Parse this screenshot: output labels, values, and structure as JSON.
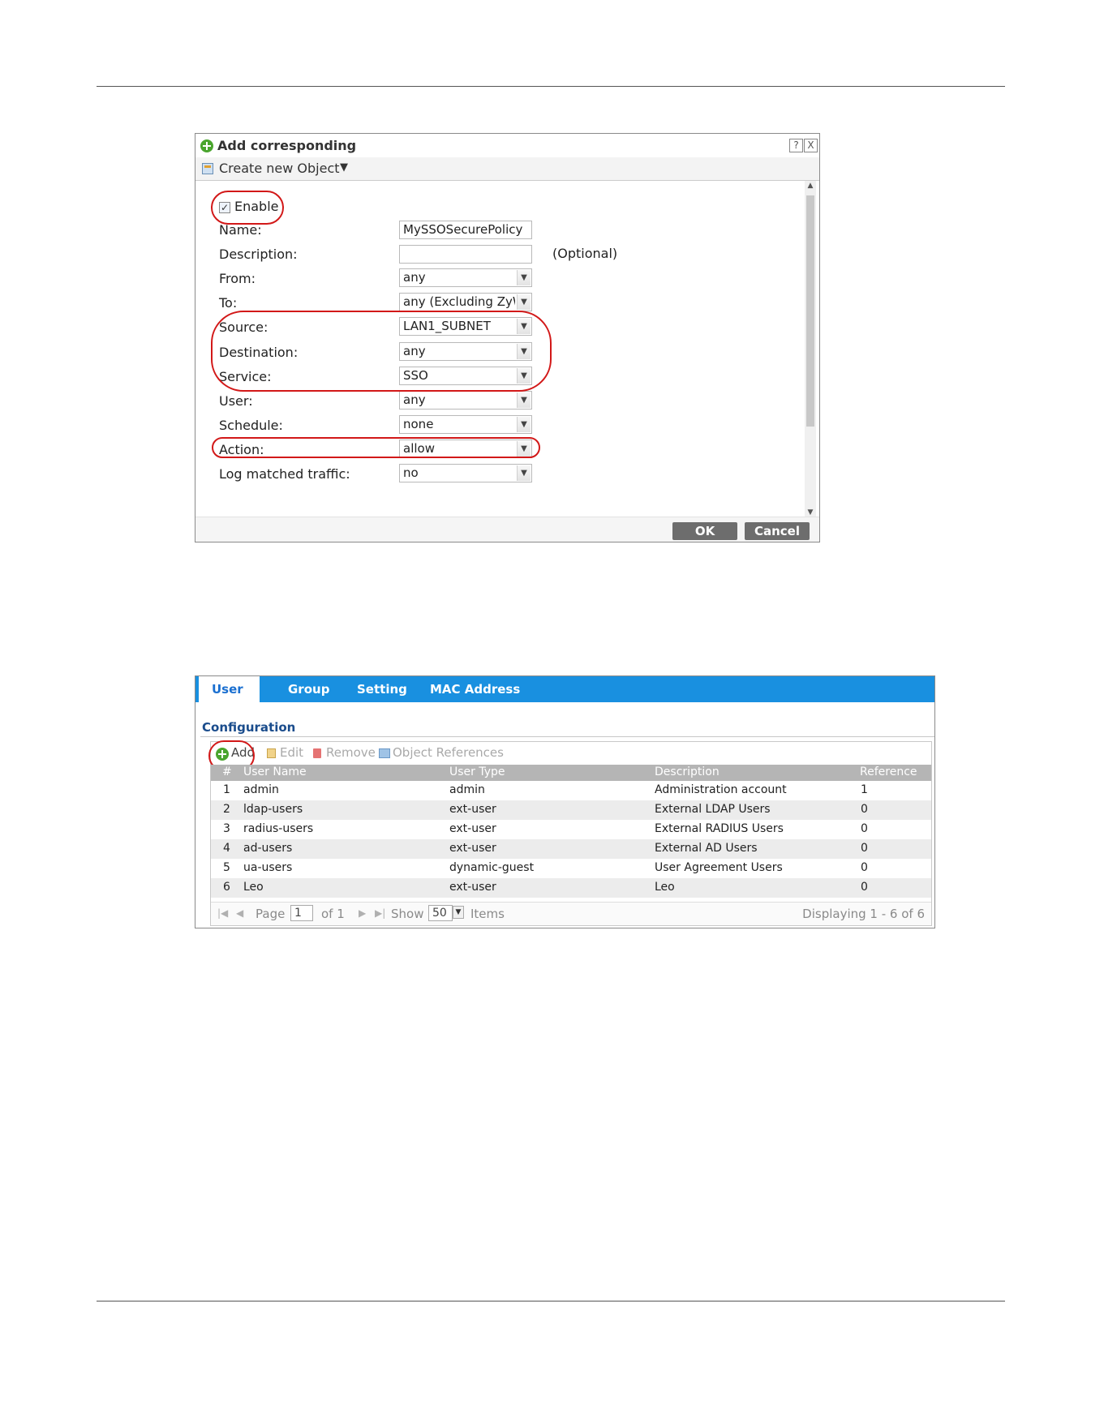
{
  "dialog": {
    "title": "Add corresponding",
    "help_label": "?",
    "close_label": "X",
    "create_new_object": "Create new Object",
    "create_caret": "▼",
    "enable_label": "Enable",
    "enable_checked": true,
    "fields": {
      "name": {
        "label": "Name:",
        "value": "MySSOSecurePolicy"
      },
      "description": {
        "label": "Description:",
        "value": "",
        "hint": "(Optional)"
      },
      "from": {
        "label": "From:",
        "value": "any"
      },
      "to": {
        "label": "To:",
        "value": "any (Excluding ZyW"
      },
      "source": {
        "label": "Source:",
        "value": "LAN1_SUBNET"
      },
      "destination": {
        "label": "Destination:",
        "value": "any"
      },
      "service": {
        "label": "Service:",
        "value": "SSO"
      },
      "user": {
        "label": "User:",
        "value": "any"
      },
      "schedule": {
        "label": "Schedule:",
        "value": "none"
      },
      "action": {
        "label": "Action:",
        "value": "allow"
      },
      "log": {
        "label": "Log matched traffic:",
        "value": "no"
      }
    },
    "ok_label": "OK",
    "cancel_label": "Cancel",
    "highlight_color": "#d21818"
  },
  "user_panel": {
    "tabs": [
      "User",
      "Group",
      "Setting",
      "MAC Address"
    ],
    "active_tab": "User",
    "section_title": "Configuration",
    "toolbar": {
      "add": "Add",
      "edit": "Edit",
      "remove": "Remove",
      "references": "Object References"
    },
    "columns": [
      "#",
      "User Name",
      "User Type",
      "Description",
      "Reference"
    ],
    "rows": [
      {
        "n": "1",
        "name": "admin",
        "type": "admin",
        "desc": "Administration account",
        "ref": "1"
      },
      {
        "n": "2",
        "name": "ldap-users",
        "type": "ext-user",
        "desc": "External LDAP Users",
        "ref": "0"
      },
      {
        "n": "3",
        "name": "radius-users",
        "type": "ext-user",
        "desc": "External RADIUS Users",
        "ref": "0"
      },
      {
        "n": "4",
        "name": "ad-users",
        "type": "ext-user",
        "desc": "External AD Users",
        "ref": "0"
      },
      {
        "n": "5",
        "name": "ua-users",
        "type": "dynamic-guest",
        "desc": "User Agreement Users",
        "ref": "0"
      },
      {
        "n": "6",
        "name": "Leo",
        "type": "ext-user",
        "desc": "Leo",
        "ref": "0"
      }
    ],
    "pager": {
      "page_label": "Page",
      "page_value": "1",
      "of_label": "of 1",
      "show_label": "Show",
      "show_value": "50",
      "items_label": "Items",
      "displaying": "Displaying 1 - 6 of 6"
    },
    "accent_color": "#1990e0"
  }
}
